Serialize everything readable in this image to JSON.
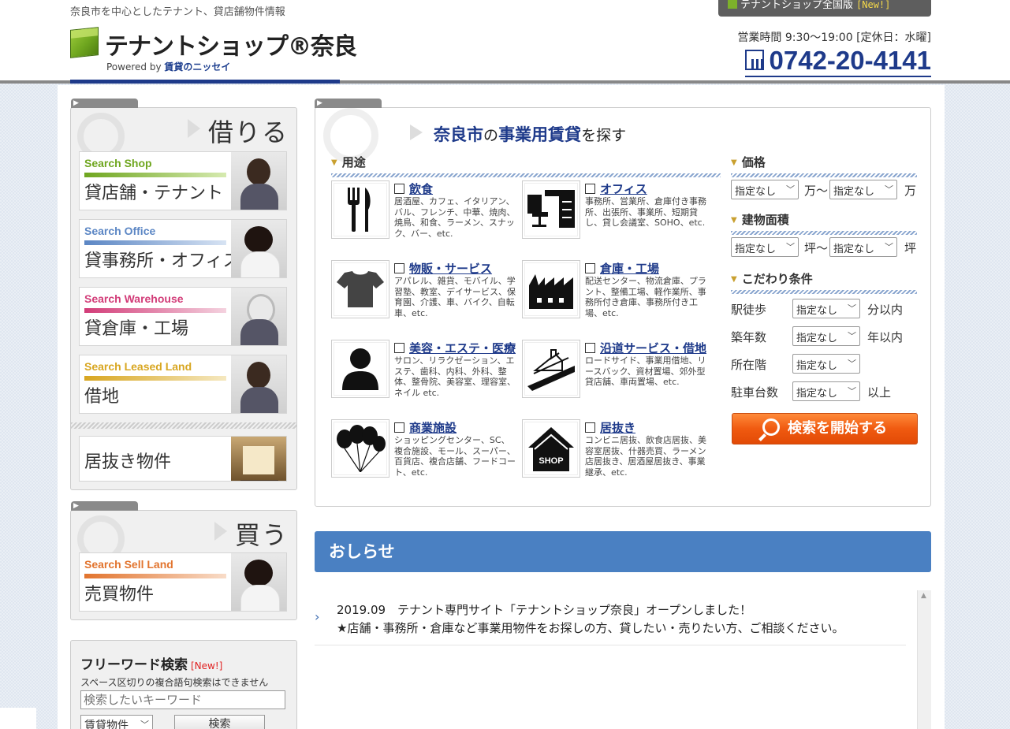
{
  "header": {
    "tagline": "奈良市を中心としたテナント、貸店舗物件情報",
    "logo_title": "テナントショップ®奈良",
    "logo_powered_prefix": "Powered by",
    "logo_powered_brand": "賃貸のニッセイ",
    "national_tab": "テナントショップ全国版",
    "national_new": "[New!]",
    "hours": "営業時間 9:30～19:00 [定休日：水曜]",
    "phone": "0742-20-4141"
  },
  "sidebar": {
    "rent_heading": "借りる",
    "cards": [
      {
        "en": "Search Shop",
        "ja": "貸店舗・テナント",
        "color": "#6fa61f"
      },
      {
        "en": "Search Office",
        "ja": "貸事務所・オフィス",
        "color": "#5b86c4"
      },
      {
        "en": "Search Warehouse",
        "ja": "貸倉庫・工場",
        "color": "#d23c78"
      },
      {
        "en": "Search Leased Land",
        "ja": "借地",
        "color": "#d8a620"
      }
    ],
    "inuki": "居抜き物件",
    "buy_heading": "買う",
    "buy_card": {
      "en": "Search Sell Land",
      "ja": "売買物件",
      "color": "#e2742e"
    },
    "freeword": {
      "title": "フリーワード検索",
      "new": "[New!]",
      "note": "スペース区切りの複合語句検索はできません",
      "placeholder": "検索したいキーワード",
      "select_value": "賃貸物件",
      "button": "検索"
    }
  },
  "search": {
    "title_city": "奈良市",
    "title_no": "の",
    "title_main": "事業用賃貸",
    "title_end": "を探す",
    "use_heading": "用途",
    "categories": [
      {
        "label": "飲食",
        "desc": "居酒屋、カフェ、イタリアン、バル、フレンチ、中華、焼肉、焼鳥、和食、ラーメン、スナック、バー、etc.",
        "icon": "fork-knife-icon"
      },
      {
        "label": "オフィス",
        "desc": "事務所、営業所、倉庫付き事務所、出張所、事業所、短期貸し、貸し会議室、SOHO、etc.",
        "icon": "office-desk-icon"
      },
      {
        "label": "物販・サービス",
        "desc": "アパレル、雑貨、モバイル、学習塾、教室、デイサービス、保育園、介護、車、バイク、自転車、etc.",
        "icon": "tshirt-icon"
      },
      {
        "label": "倉庫・工場",
        "desc": "配送センター、物流倉庫、プラント、整備工場、軽作業所、事務所付き倉庫、事務所付き工場、etc.",
        "icon": "factory-icon"
      },
      {
        "label": "美容・エステ・医療",
        "desc": "サロン、リラクゼーション、エステ、歯科、内科、外科、整体、整骨院、美容室、理容室、ネイル etc.",
        "icon": "person-icon"
      },
      {
        "label": "沿道サービス・借地",
        "desc": "ロードサイド、事業用借地、リースバック、資材置場、郊外型貸店舗、車両置場、etc.",
        "icon": "roadside-icon"
      },
      {
        "label": "商業施設",
        "desc": "ショッピングセンター、SC、複合施設、モール、スーパー、百貨店、複合店舗、フードコート、etc.",
        "icon": "balloons-icon"
      },
      {
        "label": "居抜き",
        "desc": "コンビニ居抜、飲食店居抜、美容室居抜、什器売買、ラーメン店居抜き、居酒屋居抜き、事業継承、etc.",
        "icon": "shop-house-icon"
      }
    ],
    "price": {
      "heading": "価格",
      "from": "指定なし",
      "unit1": "万～",
      "to": "指定なし",
      "unit2": "万"
    },
    "area": {
      "heading": "建物面積",
      "from": "指定なし",
      "unit1": "坪～",
      "to": "指定なし",
      "unit2": "坪"
    },
    "cond": {
      "heading": "こだわり条件",
      "rows": [
        {
          "label": "駅徒歩",
          "value": "指定なし",
          "suffix": "分以内"
        },
        {
          "label": "築年数",
          "value": "指定なし",
          "suffix": "年以内"
        },
        {
          "label": "所在階",
          "value": "指定なし",
          "suffix": ""
        },
        {
          "label": "駐車台数",
          "value": "指定なし",
          "suffix": "以上"
        }
      ]
    },
    "start_button": "検索を開始する"
  },
  "news": {
    "heading": "おしらせ",
    "item_line1": "2019.09　テナント専門サイト「テナントショップ奈良」オープンしました！",
    "item_line2": "★店舗・事務所・倉庫など事業用物件をお探しの方、貸したい・売りたい方、ご相談ください。"
  }
}
